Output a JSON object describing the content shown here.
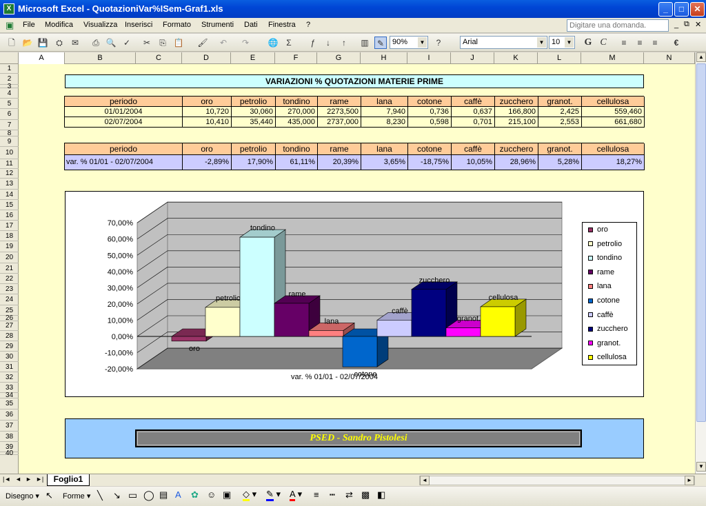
{
  "window": {
    "title": "Microsoft Excel - QuotazioniVar%ISem-Graf1.xls",
    "min": "_",
    "max": "□",
    "close": "✕"
  },
  "menu": {
    "items": [
      "File",
      "Modifica",
      "Visualizza",
      "Inserisci",
      "Formato",
      "Strumenti",
      "Dati",
      "Finestra",
      "?"
    ],
    "ask_placeholder": "Digitare una domanda."
  },
  "toolbar": {
    "zoom": "90%",
    "font": "Arial",
    "size": "10"
  },
  "sheet": {
    "columns": [
      "A",
      "B",
      "C",
      "D",
      "E",
      "F",
      "G",
      "H",
      "I",
      "J",
      "K",
      "L",
      "M",
      "N"
    ],
    "rows": [
      "1",
      "2",
      "3",
      "4",
      "5",
      "6",
      "7",
      "8",
      "9",
      "10",
      "11",
      "12",
      "13",
      "14",
      "15",
      "16",
      "17",
      "18",
      "19",
      "20",
      "21",
      "22",
      "23",
      "24",
      "25",
      "26",
      "27",
      "28",
      "29",
      "30",
      "31",
      "32",
      "33",
      "34",
      "35",
      "36",
      "37",
      "38",
      "39",
      "40"
    ],
    "title": "VARIAZIONI % QUOTAZIONI MATERIE PRIME",
    "table1": {
      "headers": [
        "periodo",
        "oro",
        "petrolio",
        "tondino",
        "rame",
        "lana",
        "cotone",
        "caffè",
        "zucchero",
        "granot.",
        "cellulosa"
      ],
      "rows": [
        [
          "01/01/2004",
          "10,720",
          "30,060",
          "270,000",
          "2273,500",
          "7,940",
          "0,736",
          "0,637",
          "166,800",
          "2,425",
          "559,460"
        ],
        [
          "02/07/2004",
          "10,410",
          "35,440",
          "435,000",
          "2737,000",
          "8,230",
          "0,598",
          "0,701",
          "215,100",
          "2,553",
          "661,680"
        ]
      ]
    },
    "table2": {
      "headers": [
        "periodo",
        "oro",
        "petrolio",
        "tondino",
        "rame",
        "lana",
        "cotone",
        "caffè",
        "zucchero",
        "granot.",
        "cellulosa"
      ],
      "row": [
        "var. % 01/01 - 02/07/2004",
        "-2,89%",
        "17,90%",
        "61,11%",
        "20,39%",
        "3,65%",
        "-18,75%",
        "10,05%",
        "28,96%",
        "5,28%",
        "18,27%"
      ]
    },
    "footer": "PSED - Sandro Pistolesi",
    "tab": "Foglio1"
  },
  "chart_data": {
    "type": "bar",
    "categories": [
      "oro",
      "petrolio",
      "tondino",
      "rame",
      "lana",
      "cotone",
      "caffè",
      "zucchero",
      "granot.",
      "cellulosa"
    ],
    "values": [
      -2.89,
      17.9,
      61.11,
      20.39,
      3.65,
      -18.75,
      10.05,
      28.96,
      5.28,
      18.27
    ],
    "colors": [
      "#993366",
      "#ffffcc",
      "#ccffff",
      "#660066",
      "#ff8080",
      "#0066cc",
      "#ccccff",
      "#000080",
      "#ff00ff",
      "#ffff00"
    ],
    "xlabel": "var. % 01/01 - 02/07/2004",
    "yticks": [
      "70,00%",
      "60,00%",
      "50,00%",
      "40,00%",
      "30,00%",
      "20,00%",
      "10,00%",
      "0,00%",
      "-10,00%",
      "-20,00%"
    ],
    "ylim": [
      -20,
      70
    ],
    "legend": "right"
  },
  "drawbar": {
    "draw": "Disegno",
    "shapes": "Forme"
  }
}
